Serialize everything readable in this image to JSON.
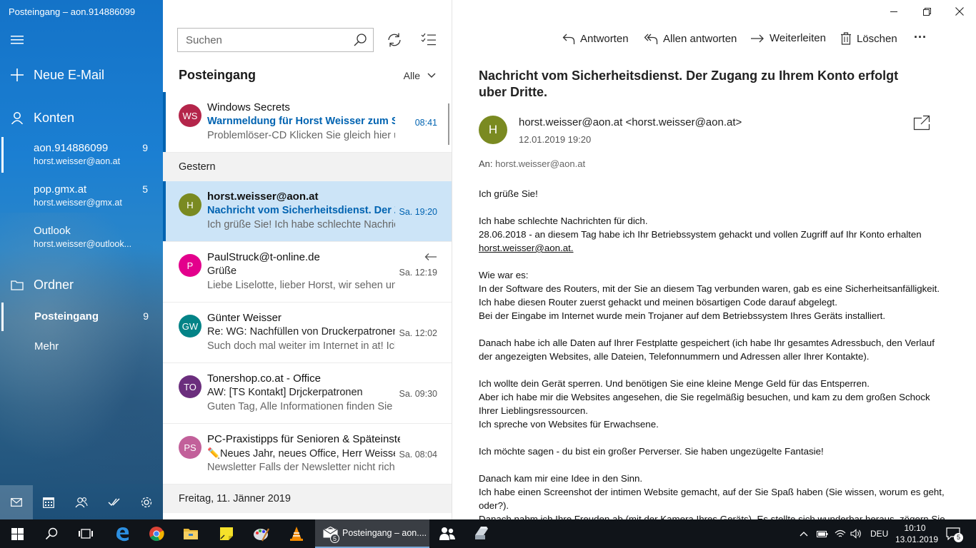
{
  "window": {
    "title": "Posteingang – aon.914886099"
  },
  "nav": {
    "new_mail": "Neue E-Mail",
    "accounts_label": "Konten",
    "accounts": [
      {
        "name": "aon.914886099",
        "email": "horst.weisser@aon.at",
        "count": "9"
      },
      {
        "name": "pop.gmx.at",
        "email": "horst.weisser@gmx.at",
        "count": "5"
      },
      {
        "name": "Outlook",
        "email": "horst.weisser@outlook...",
        "count": ""
      }
    ],
    "folders_label": "Ordner",
    "folders": [
      {
        "name": "Posteingang",
        "count": "9"
      },
      {
        "name": "Mehr",
        "count": ""
      }
    ]
  },
  "list": {
    "search_placeholder": "Suchen",
    "folder_title": "Posteingang",
    "filter": "Alle",
    "groups": {
      "yesterday": "Gestern",
      "friday": "Freitag, 11. Jänner 2019"
    },
    "messages": [
      {
        "initials": "WS",
        "avatar_color": "#b4254a",
        "from": "Windows Secrets",
        "subject": "Warnmeldung für Horst Weisser zum Support",
        "preview": "Problemlöser-CD Klicken Sie gleich hier und",
        "time": "08:41",
        "unread": true
      },
      {
        "initials": "H",
        "avatar_color": "#7a8a21",
        "from": "horst.weisser@aon.at",
        "subject": "Nachricht vom Sicherheitsdienst. Der Zugang",
        "preview": "Ich grüße Sie! Ich habe schlechte Nachrichten",
        "time": "Sa. 19:20",
        "unread": true
      },
      {
        "initials": "P",
        "avatar_color": "#e3008c",
        "from": "PaulStruck@t-online.de",
        "subject": "Grüße",
        "preview": "Liebe Liselotte, lieber Horst, wir sehen uns",
        "time": "Sa. 12:19",
        "unread": false
      },
      {
        "initials": "GW",
        "avatar_color": "#038387",
        "from": "Günter Weisser",
        "subject": "Re: WG: Nachfüllen von Druckerpatronen",
        "preview": "Such doch mal weiter im Internet in at! Ich",
        "time": "Sa. 12:02",
        "unread": false
      },
      {
        "initials": "TO",
        "avatar_color": "#6b2e7d",
        "from": "Tonershop.co.at - Office",
        "subject": "AW: [TS Kontakt] Drjckerpatronen",
        "preview": "Guten Tag, Alle Informationen finden Sie",
        "time": "Sa. 09:30",
        "unread": false
      },
      {
        "initials": "PS",
        "avatar_color": "#c2609a",
        "from": "PC-Praxistipps für Senioren & Späteinsteiger",
        "subject": "✏️Neues Jahr, neues Office, Herr Weisser",
        "preview": "Newsletter Falls der Newsletter nicht richtig",
        "time": "Sa. 08:04",
        "unread": false
      }
    ]
  },
  "commands": {
    "reply": "Antworten",
    "reply_all": "Allen antworten",
    "forward": "Weiterleiten",
    "delete": "Löschen",
    "more": "···"
  },
  "reading": {
    "subject": "Nachricht vom Sicherheitsdienst. Der Zugang zu Ihrem Konto erfolgt uber Dritte.",
    "sender_initial": "H",
    "from": "horst.weisser@aon.at  <horst.weisser@aon.at>",
    "date": "12.01.2019 19:20",
    "to_label": "An:",
    "to": "horst.weisser@aon.at",
    "body": [
      "Ich grüße Sie!",
      "",
      "Ich habe schlechte Nachrichten für dich.",
      "28.06.2018 - an diesem Tag habe ich Ihr Betriebssystem gehackt und vollen Zugriff auf Ihr Konto erhalten",
      "horst.weisser@aon.at.",
      "",
      "Wie war es:",
      "In der Software des Routers, mit der Sie an diesem Tag verbunden waren, gab es eine Sicherheitsanfälligkeit.",
      "Ich habe diesen Router zuerst gehackt und meinen bösartigen Code darauf abgelegt.",
      "Bei der Eingabe im Internet wurde mein Trojaner auf dem Betriebssystem Ihres Geräts installiert.",
      "",
      "Danach habe ich alle Daten auf Ihrer Festplatte gespeichert (ich habe Ihr gesamtes Adressbuch, den Verlauf",
      "der angezeigten Websites, alle Dateien, Telefonnummern und Adressen aller Ihrer Kontakte).",
      "",
      "Ich wollte dein Gerät sperren. Und benötigen Sie eine kleine Menge Geld für das Entsperren.",
      "Aber ich habe mir die Websites angesehen, die Sie regelmäßig besuchen, und kam zu dem großen Schock",
      "Ihrer Lieblingsressourcen.",
      "Ich spreche von Websites für Erwachsene.",
      "",
      "Ich möchte sagen - du bist ein großer Perverser. Sie haben ungezügelte Fantasie!",
      "",
      "Danach kam mir eine Idee in den Sinn.",
      "Ich habe einen Screenshot der intimen Website gemacht, auf der Sie Spaß haben (Sie wissen, worum es geht,",
      "oder?).",
      "Danach nahm ich Ihre Freuden ab (mit der Kamera Ihres Geräts). Es stellte sich wunderbar heraus, zögern Sie"
    ]
  },
  "taskbar": {
    "active_app": "Posteingang – aon....",
    "app_badge": "5",
    "language": "DEU",
    "time": "10:10",
    "date": "13.01.2019",
    "notif_count": "5"
  }
}
